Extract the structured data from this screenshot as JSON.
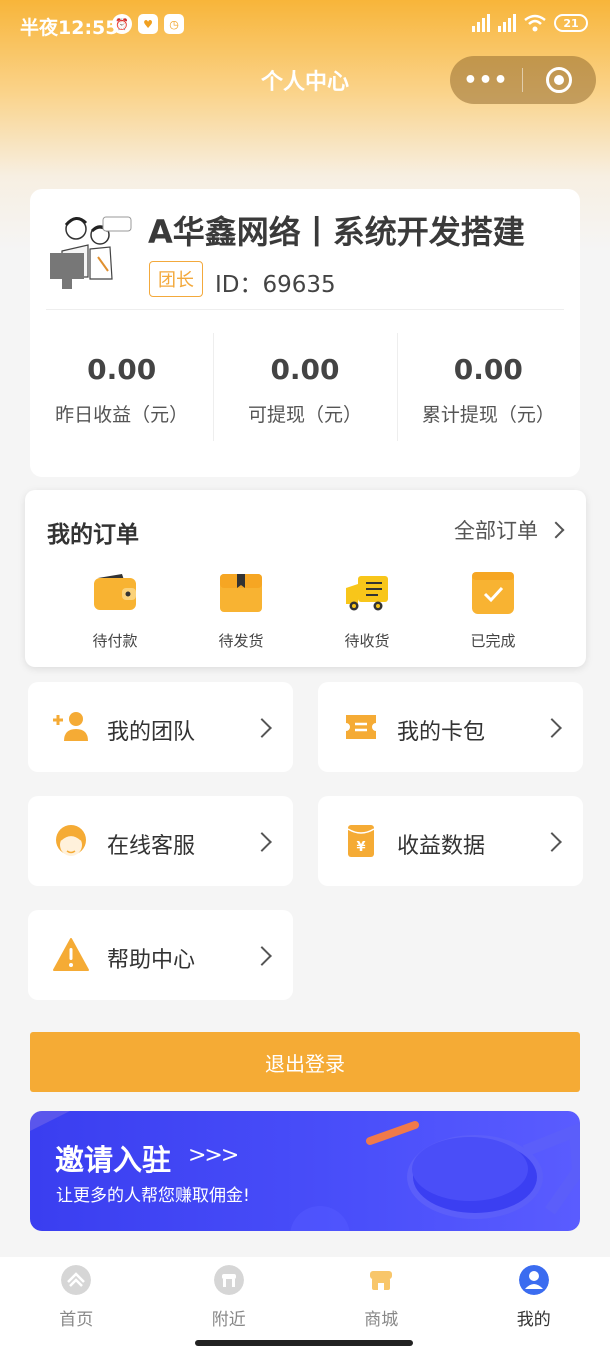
{
  "status_bar": {
    "time": "半夜12:55",
    "battery": "21"
  },
  "nav": {
    "title": "个人中心",
    "more_label": "•••"
  },
  "profile": {
    "name": "A华鑫网络丨系统开发搭建",
    "role": "团长",
    "id_label": "ID：",
    "id_value": "69635",
    "stats": [
      {
        "value": "0.00",
        "label": "昨日收益（元）"
      },
      {
        "value": "0.00",
        "label": "可提现（元）"
      },
      {
        "value": "0.00",
        "label": "累计提现（元）"
      }
    ]
  },
  "orders": {
    "title": "我的订单",
    "all_label": "全部订单",
    "items": [
      {
        "label": "待付款",
        "icon": "wallet-icon"
      },
      {
        "label": "待发货",
        "icon": "package-icon"
      },
      {
        "label": "待收货",
        "icon": "truck-icon"
      },
      {
        "label": "已完成",
        "icon": "check-box-icon"
      }
    ]
  },
  "menu": [
    {
      "label": "我的团队",
      "icon": "add-user-icon"
    },
    {
      "label": "我的卡包",
      "icon": "card-icon"
    },
    {
      "label": "在线客服",
      "icon": "customer-service-icon"
    },
    {
      "label": "收益数据",
      "icon": "yuan-envelope-icon"
    },
    {
      "label": "帮助中心",
      "icon": "warning-icon"
    }
  ],
  "logout_label": "退出登录",
  "invite": {
    "title": "邀请入驻",
    "arrows": ">>>",
    "subtitle": "让更多的人帮您赚取佣金!"
  },
  "tabs": [
    {
      "label": "首页",
      "icon": "home-icon"
    },
    {
      "label": "附近",
      "icon": "store-icon"
    },
    {
      "label": "商城",
      "icon": "mall-icon"
    },
    {
      "label": "我的",
      "icon": "profile-icon"
    }
  ],
  "colors": {
    "accent": "#f5ab35",
    "invite_blue": "#3f44f4",
    "active_tab": "#3b6cf0"
  }
}
